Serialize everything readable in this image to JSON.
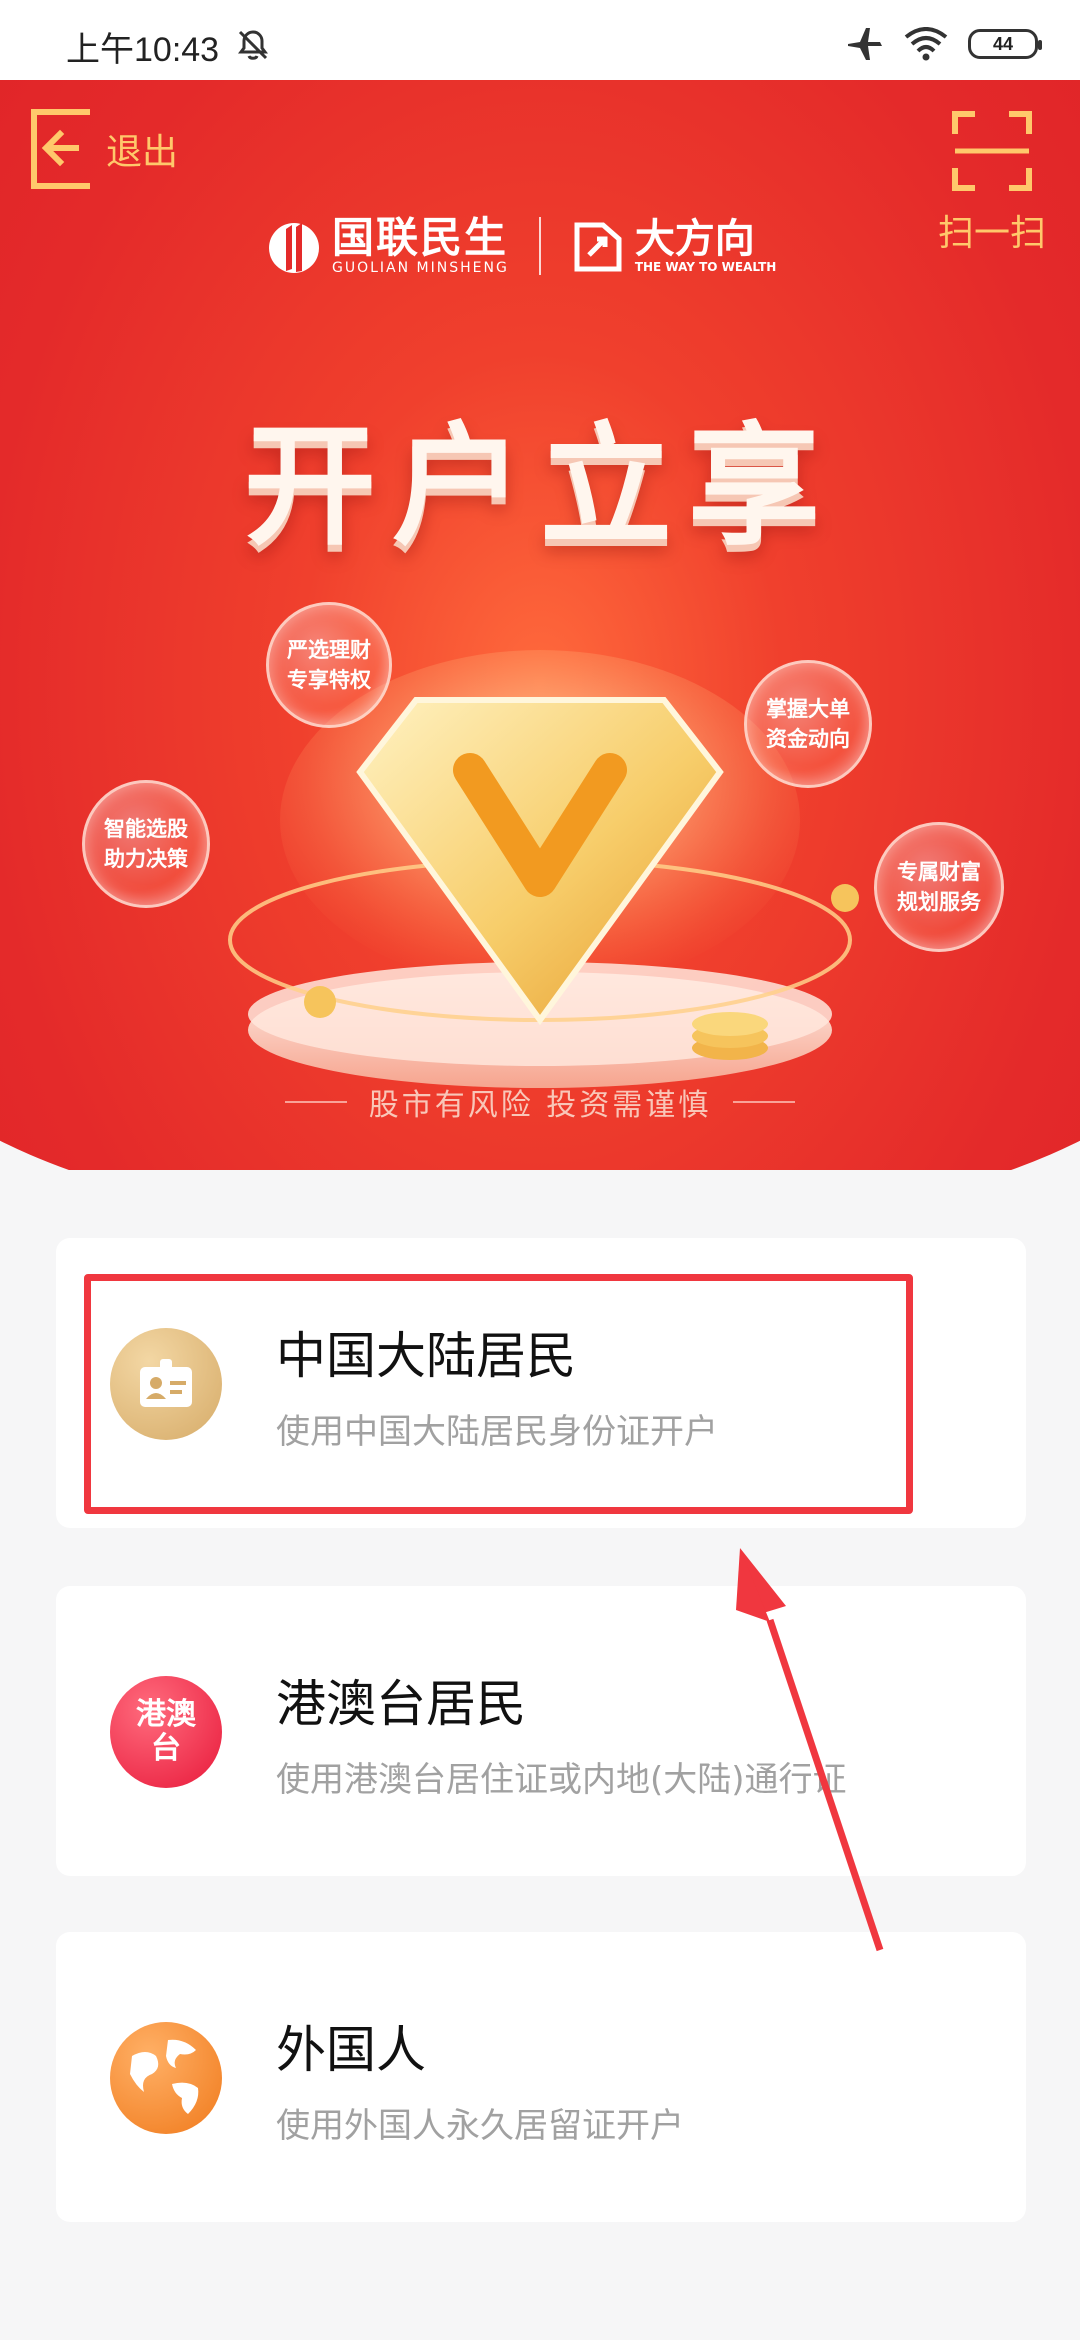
{
  "status_bar": {
    "time": "上午10:43",
    "battery": "44"
  },
  "header": {
    "exit_label": "退出",
    "scan_label": "扫一扫"
  },
  "brand": {
    "logo1_cn": "国联民生",
    "logo1_en": "GUOLIAN MINSHENG",
    "logo2_cn": "大方向",
    "logo2_en": "THE WAY TO WEALTH"
  },
  "hero": {
    "headline": "开户立享",
    "features": [
      {
        "line1": "严选理财",
        "line2": "专享特权"
      },
      {
        "line1": "掌握大单",
        "line2": "资金动向"
      },
      {
        "line1": "智能选股",
        "line2": "助力决策"
      },
      {
        "line1": "专属财富",
        "line2": "规划服务"
      }
    ],
    "disclaimer": "股市有风险  投资需谨慎"
  },
  "options": [
    {
      "title": "中国大陆居民",
      "subtitle": "使用中国大陆居民身份证开户"
    },
    {
      "title": "港澳台居民",
      "subtitle": "使用港澳台居住证或内地(大陆)通行证",
      "icon_text_1": "港澳",
      "icon_text_2": "台"
    },
    {
      "title": "外国人",
      "subtitle": "使用外国人永久居留证开户"
    }
  ],
  "colors": {
    "brand_red": "#e42a2a",
    "gold": "#ffc86b",
    "highlight": "#f0373f"
  }
}
